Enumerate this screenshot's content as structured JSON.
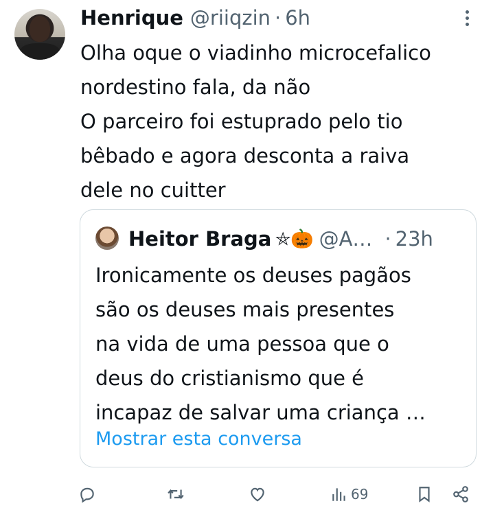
{
  "tweet": {
    "author_name": "Henrique",
    "author_handle": "@riiqzin",
    "separator": "·",
    "time": "6h",
    "text": "Olha oque o viadinho microcefalico\nnordestino fala, da não\nO parceiro foi estuprado pelo tio\nbêbado e agora desconta a raiva\ndele no cuitter"
  },
  "quote": {
    "author_name": "Heitor Braga",
    "author_emoji": "⛤🎃",
    "author_handle": "@A…",
    "separator": "·",
    "time": "23h",
    "text": "Ironicamente os deuses pagãos\nsão os deuses mais presentes\nna vida de uma pessoa que o\ndeus do cristianismo que é\nincapaz de salvar uma criança …",
    "show_thread_label": "Mostrar esta conversa"
  },
  "actions": {
    "reply_icon": "reply-icon",
    "retweet_icon": "retweet-icon",
    "like_icon": "heart-icon",
    "views_icon": "views-icon",
    "views_count": "69",
    "bookmark_icon": "bookmark-icon",
    "share_icon": "share-icon"
  },
  "colors": {
    "link": "#1d9bf0",
    "secondary_text": "#536471",
    "border": "#cfd9de"
  }
}
